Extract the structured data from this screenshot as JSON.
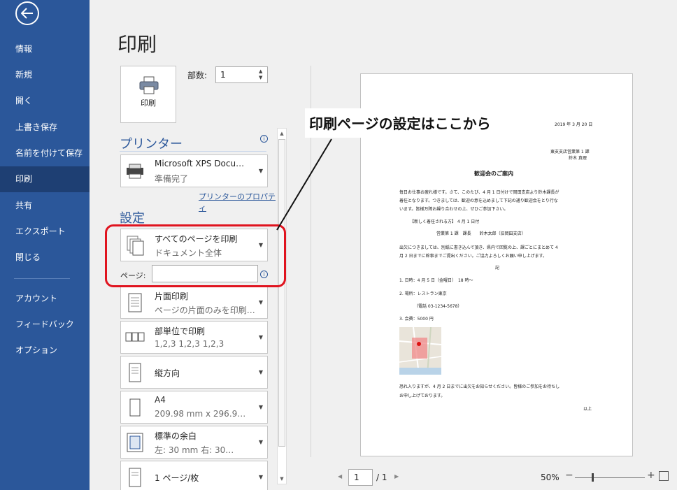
{
  "nav": {
    "items": [
      "情報",
      "新規",
      "開く",
      "上書き保存",
      "名前を付けて保存",
      "印刷",
      "共有",
      "エクスポート",
      "閉じる"
    ],
    "bottom_items": [
      "アカウント",
      "フィードバック",
      "オプション"
    ],
    "active": "印刷"
  },
  "title": "印刷",
  "print_button": {
    "label": "印刷"
  },
  "copies": {
    "label": "部数:",
    "value": "1"
  },
  "printer": {
    "header": "プリンター",
    "name": "Microsoft XPS Docu…",
    "status": "準備完了",
    "properties_link": "プリンターのプロパティ"
  },
  "settings": {
    "header": "設定",
    "print_range": {
      "line1": "すべてのページを印刷",
      "line2": "ドキュメント全体"
    },
    "pages_label": "ページ:",
    "pages_value": "",
    "sides": {
      "line1": "片面印刷",
      "line2": "ページの片面のみを印刷…"
    },
    "collate": {
      "line1": "部単位で印刷",
      "line2": "1,2,3    1,2,3    1,2,3"
    },
    "orientation": {
      "line1": "縦方向"
    },
    "paper": {
      "line1": "A4",
      "line2": "209.98 mm x 296.9…"
    },
    "margins": {
      "line1": "標準の余白",
      "line2": "左: 30 mm    右: 30…"
    },
    "per_sheet": {
      "line1": "1 ページ/枚"
    }
  },
  "callout": "印刷ページの設定はここから",
  "preview": {
    "date": "2019 年 3 月 20 日",
    "dept": "東支支店営業第 1 課",
    "from": "鈴木  真理",
    "doc_title": "歓迎会のご案内",
    "body1": "毎日お仕事お疲れ様です。さて、このたび、4 月 1 日付けで岡田支店より鈴木課長が",
    "body2": "着任となります。つきましては、歓迎の意を込めまして下記の通り歓迎会をとり行な",
    "body3": "います。皆様万障お繰り合わせの上、ぜひご参加下さい。",
    "new_label": "【新しく着任される方】 4 月 1 日付",
    "new_person": "営業第 1 課　課長　　鈴木太郎（旧岡田支店）",
    "rsvp1": "出欠につきましては、別紙に書き込んで頂き、県内で回覧の上、課ごとにまとめて 4",
    "rsvp2": "月 2 日までに幹事までご提出ください。ご協力よろしくお願い申し上げます。",
    "ki": "記",
    "item1": "1. 日時：4 月 5 日（金曜日）　18 時～",
    "item2": "2. 場所：レストラン東京",
    "item2b": "（電話 03-1234-5678）",
    "item3": "3. 会費：5000 円",
    "close1": "恐れ入りますが、4 月 2 日までに出欠をお知らせください。皆様のご参加をお待ちし",
    "close2": "お申し上げております。",
    "ijou": "以上"
  },
  "bottom": {
    "page_value": "1",
    "page_of": "/ 1",
    "zoom": "50%"
  }
}
